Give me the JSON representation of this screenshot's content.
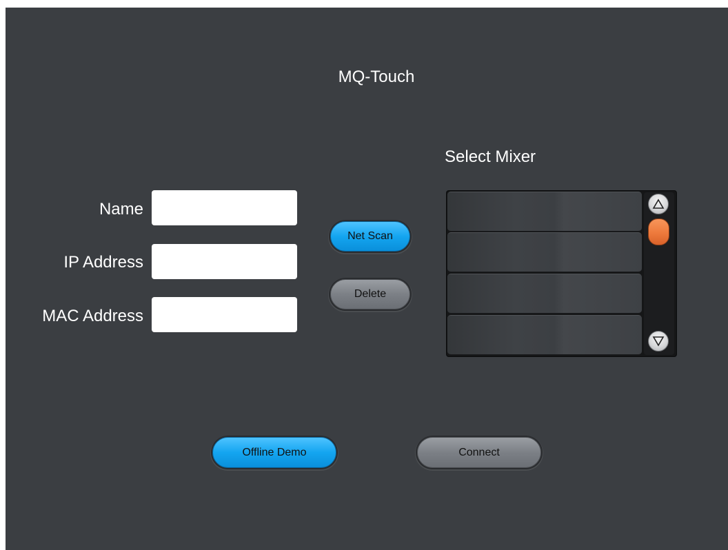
{
  "app": {
    "title": "MQ-Touch"
  },
  "form": {
    "name_label": "Name",
    "ip_label": "IP Address",
    "mac_label": "MAC Address",
    "name_value": "",
    "ip_value": "",
    "mac_value": ""
  },
  "actions": {
    "net_scan": "Net Scan",
    "delete": "Delete",
    "offline_demo": "Offline Demo",
    "connect": "Connect"
  },
  "mixer_list": {
    "title": "Select Mixer",
    "rows": [
      "",
      "",
      "",
      ""
    ],
    "scroll_position": 0.0
  },
  "colors": {
    "background": "#3b3e42",
    "accent_blue": "#14a5f0",
    "scroll_thumb": "#ee7a3c",
    "button_grey": "#7c8086"
  },
  "icons": {
    "scroll_up": "triangle-up-icon",
    "scroll_down": "triangle-down-icon"
  }
}
